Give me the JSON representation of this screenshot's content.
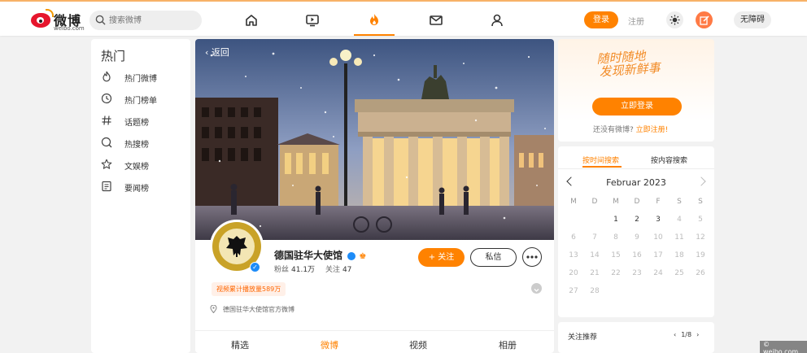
{
  "header": {
    "logo_text": "微博",
    "logo_domain": "weibo.com",
    "search_placeholder": "搜索微博",
    "nav_icons": [
      "home-icon",
      "video-icon",
      "hot-fire-icon",
      "message-icon",
      "user-icon"
    ],
    "login_label": "登录",
    "register_label": "注册",
    "accessibility_label": "无障碍",
    "accent_color": "#ff8200"
  },
  "sidebar": {
    "title": "热门",
    "items": [
      {
        "label": "热门微博",
        "icon": "fire-outline-icon"
      },
      {
        "label": "热门榜单",
        "icon": "clock-icon"
      },
      {
        "label": "话题榜",
        "icon": "hashtag-icon"
      },
      {
        "label": "热搜榜",
        "icon": "search-circle-icon"
      },
      {
        "label": "文娱榜",
        "icon": "star-icon"
      },
      {
        "label": "要闻榜",
        "icon": "document-icon"
      }
    ]
  },
  "profile": {
    "back_label": "返回",
    "name": "德国驻华大使馆",
    "fans_label": "粉丝",
    "fans_value": "41.1万",
    "following_label": "关注",
    "following_value": "47",
    "follow_button": "+ 关注",
    "message_button": "私信",
    "views_tag": "视频累计播放量589万",
    "location_text": "德国驻华大使馆官方微博",
    "tabs": [
      "精选",
      "微博",
      "视频",
      "相册"
    ],
    "active_tab": "微博"
  },
  "promo": {
    "slogan_line1": "随时随地",
    "slogan_line2": "发现新鲜事",
    "login_button": "立即登录",
    "no_account_text": "还没有微博?",
    "register_link": "立即注册!"
  },
  "calendar": {
    "tab_time": "按时间搜索",
    "tab_content": "按内容搜索",
    "month_label": "Februar 2023",
    "weekdays": [
      "M",
      "D",
      "M",
      "D",
      "F",
      "S",
      "S"
    ],
    "days": [
      [
        "",
        "",
        "1",
        "2",
        "3",
        "4",
        "5"
      ],
      [
        "6",
        "7",
        "8",
        "9",
        "10",
        "11",
        "12"
      ],
      [
        "13",
        "14",
        "15",
        "16",
        "17",
        "18",
        "19"
      ],
      [
        "20",
        "21",
        "22",
        "23",
        "24",
        "25",
        "26"
      ],
      [
        "27",
        "28",
        "",
        "",
        "",
        "",
        ""
      ]
    ],
    "active_days": [
      "1",
      "2",
      "3"
    ]
  },
  "follow_rec": {
    "title": "关注推荐",
    "page": "1/8"
  },
  "watermark": "© weibo.com"
}
